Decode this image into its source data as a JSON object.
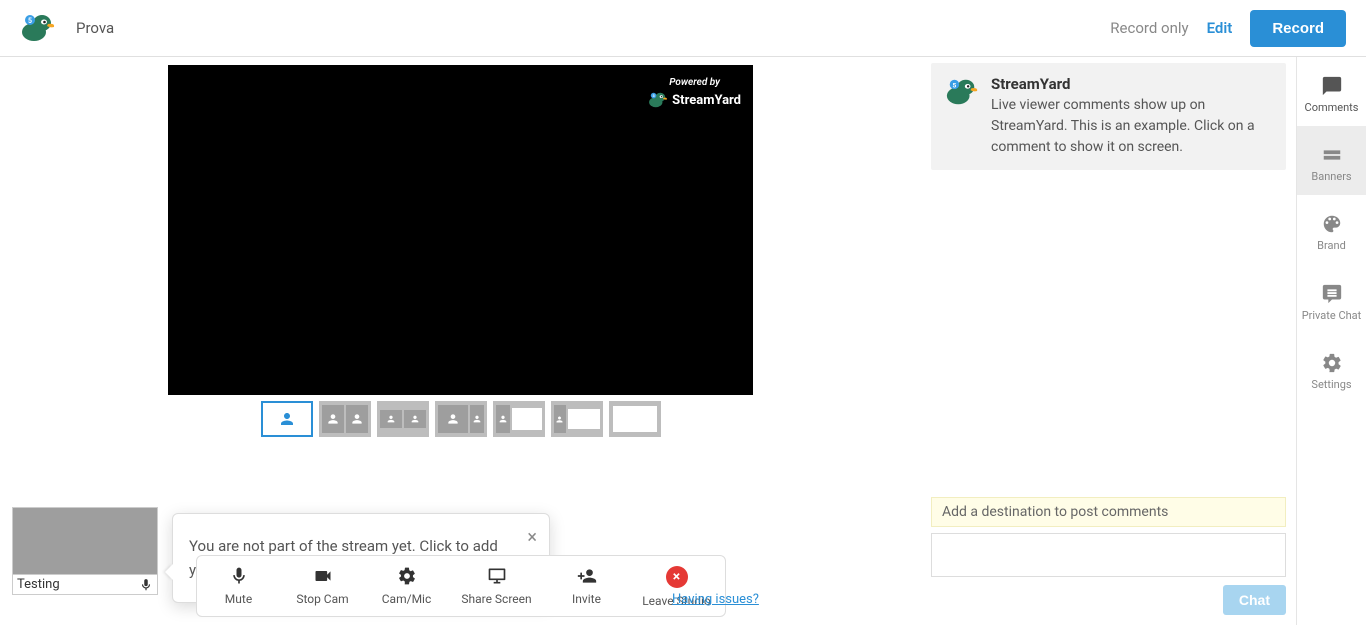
{
  "header": {
    "title": "Prova",
    "record_only": "Record only",
    "edit": "Edit",
    "record_btn": "Record"
  },
  "watermark": {
    "powered": "Powered by",
    "brand": "StreamYard"
  },
  "preview": {
    "label": "Testing"
  },
  "tooltip": {
    "text": "You are not part of the stream yet. Click to add your audio and video."
  },
  "toolbar": {
    "mute": "Mute",
    "stop_cam": "Stop Cam",
    "cam_mic": "Cam/Mic",
    "share_screen": "Share Screen",
    "invite": "Invite",
    "leave": "Leave Studio"
  },
  "issues_link": "Having issues?",
  "comments": {
    "sample_title": "StreamYard",
    "sample_body": "Live viewer comments show up on StreamYard. This is an example. Click on a comment to show it on screen.",
    "destination_bar": "Add a destination to post comments",
    "chat_btn": "Chat"
  },
  "side_tabs": {
    "comments": "Comments",
    "banners": "Banners",
    "brand": "Brand",
    "private_chat": "Private Chat",
    "settings": "Settings"
  }
}
